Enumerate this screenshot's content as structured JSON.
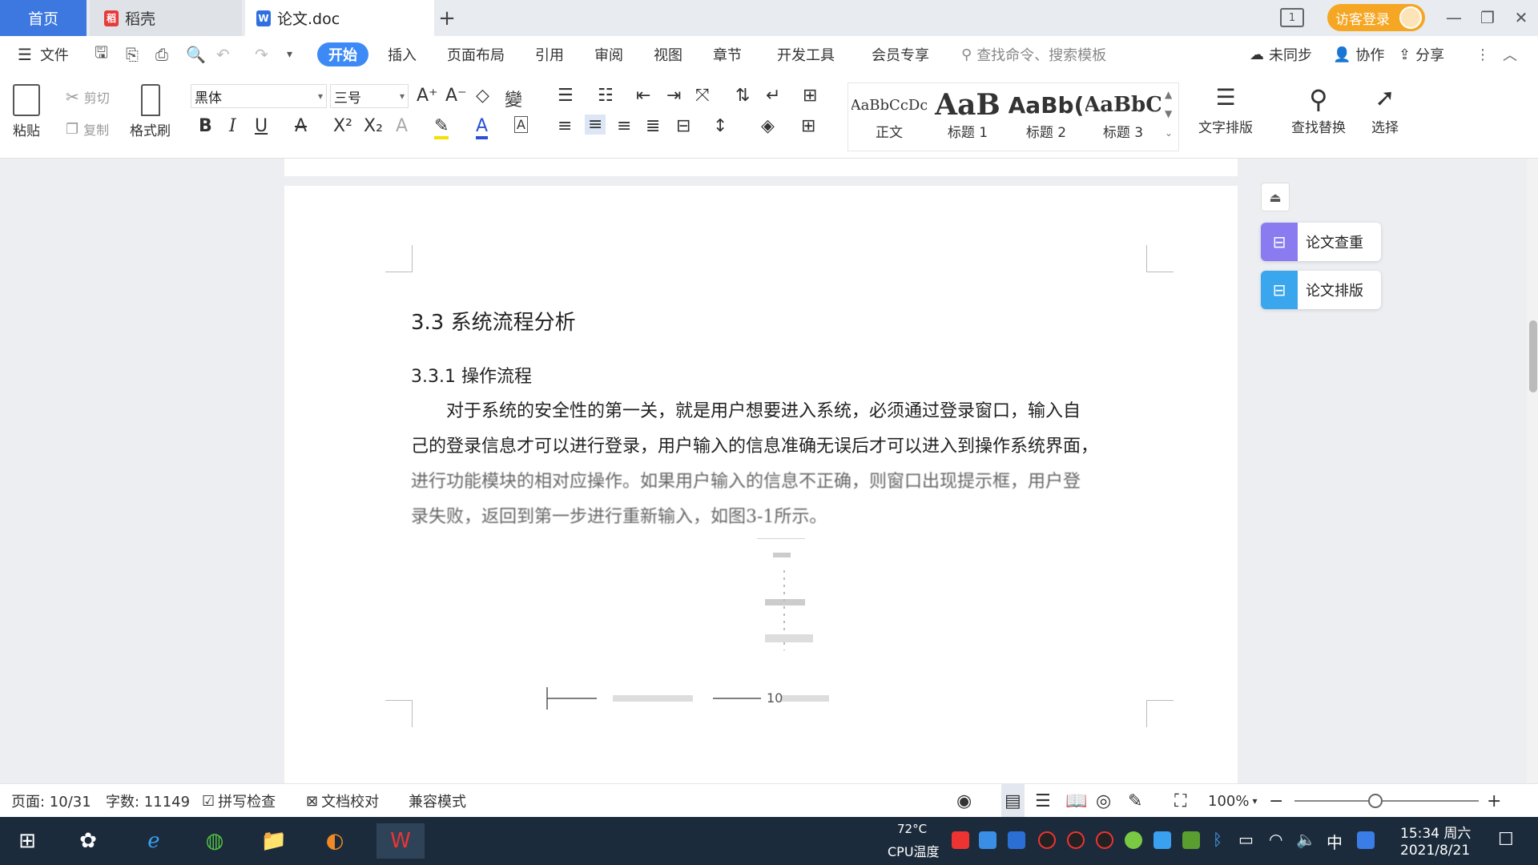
{
  "tabs": {
    "home": "首页",
    "daoke": "稻壳",
    "doc": "论文.doc",
    "add": "+"
  },
  "titlebar": {
    "visitor_login": "访客登录",
    "page_indicator": "1"
  },
  "menu": {
    "file": "文件",
    "items": [
      "开始",
      "插入",
      "页面布局",
      "引用",
      "审阅",
      "视图",
      "章节",
      "开发工具",
      "会员专享"
    ],
    "search_placeholder": "查找命令、搜索模板",
    "not_synced": "未同步",
    "collab": "协作",
    "share": "分享"
  },
  "ribbon": {
    "paste": "粘贴",
    "cut": "剪切",
    "copy": "复制",
    "format_painter": "格式刷",
    "font_name": "黑体",
    "font_size": "三号",
    "styles": [
      {
        "preview": "AaBbCcDc",
        "label": "正文"
      },
      {
        "preview": "AaB",
        "label": "标题 1"
      },
      {
        "preview": "AaBb(",
        "label": "标题 2"
      },
      {
        "preview": "AaBbC",
        "label": "标题 3"
      }
    ],
    "text_layout": "文字排版",
    "find_replace": "查找替换",
    "select": "选择"
  },
  "document": {
    "heading1": "3.3  系统流程分析",
    "heading2": "3.3.1  操作流程",
    "para_lines": [
      "对于系统的安全性的第一关，就是用户想要进入系统，必须通过登录窗口，输入自",
      "己的登录信息才可以进行登录，用户输入的信息准确无误后才可以进入到操作系统界面，",
      "进行功能模块的相对应操作。如果用户输入的信息不正确，则窗口出现提示框，用户登",
      "录失败，返回到第一步进行重新输入，如图3-1所示。"
    ],
    "page_number": "10"
  },
  "side_panel": {
    "check": "论文查重",
    "layout": "论文排版"
  },
  "statusbar": {
    "page": "页面: 10/31",
    "words": "字数: 11149",
    "spell": "拼写检查",
    "proof": "文档校对",
    "compat": "兼容模式",
    "zoom": "100%"
  },
  "taskbar": {
    "cpu_temp": "72°C",
    "cpu_label": "CPU温度",
    "ime": "中",
    "time": "15:34 周六",
    "date": "2021/8/21"
  },
  "colors": {
    "accent": "#3d78e0",
    "start_tab": "#3d8af7",
    "visitor": "#f5a623",
    "taskbar": "#1c2b3b"
  }
}
